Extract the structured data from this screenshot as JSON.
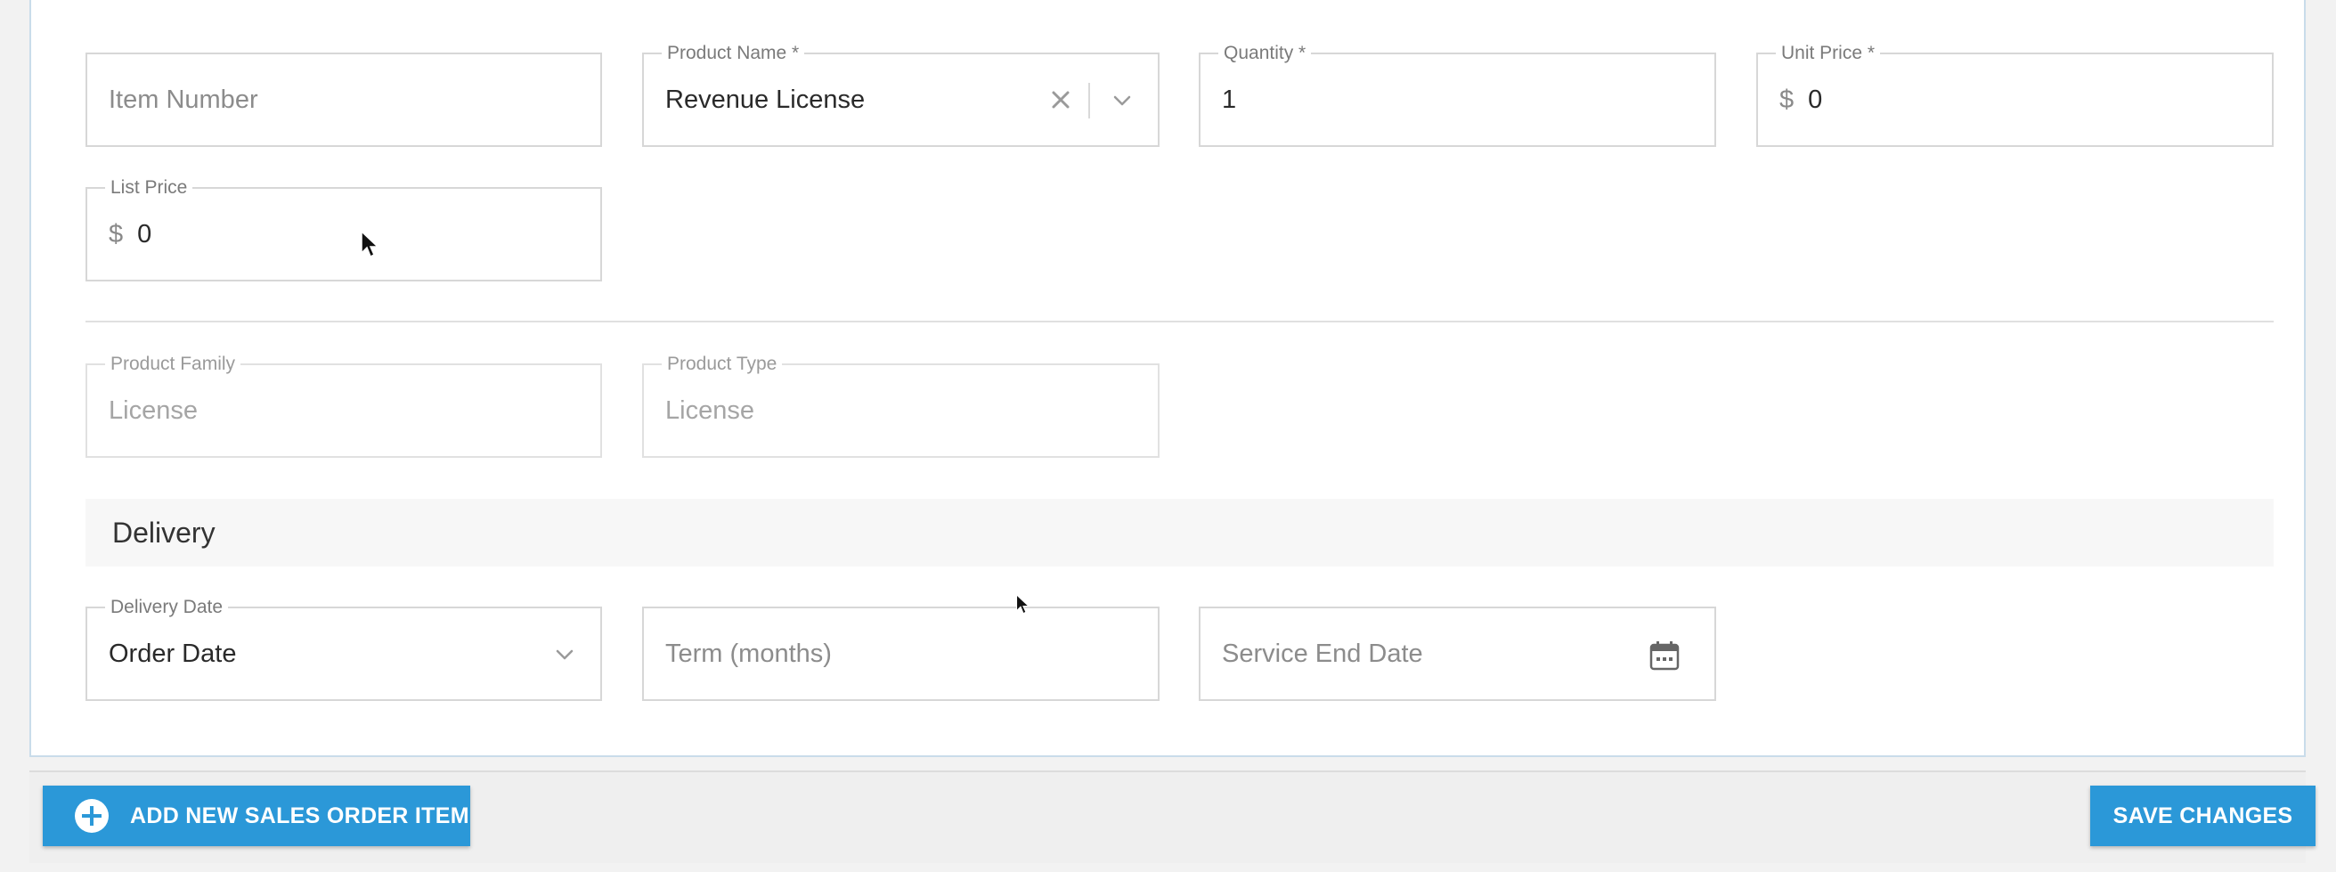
{
  "form": {
    "item_number": {
      "placeholder": "Item Number"
    },
    "product_name": {
      "label": "Product Name *",
      "value": "Revenue License",
      "clear_icon": "close-icon",
      "dropdown_icon": "chevron-down-icon"
    },
    "quantity": {
      "label": "Quantity *",
      "value": "1"
    },
    "unit_price": {
      "label": "Unit Price *",
      "currency": "$",
      "value": "0"
    },
    "list_price": {
      "label": "List Price",
      "currency": "$",
      "value": "0"
    },
    "product_family": {
      "label": "Product Family",
      "placeholder": "License"
    },
    "product_type": {
      "label": "Product Type",
      "placeholder": "License"
    }
  },
  "delivery": {
    "section_title": "Delivery",
    "delivery_date": {
      "label": "Delivery Date",
      "value": "Order Date",
      "dropdown_icon": "chevron-down-icon"
    },
    "term": {
      "placeholder": "Term (months)"
    },
    "service_end_date": {
      "placeholder": "Service End Date",
      "icon": "calendar-icon"
    }
  },
  "footer": {
    "add_button": {
      "label": "ADD NEW SALES ORDER ITEM",
      "icon": "plus-circle-icon"
    },
    "save_button": {
      "label": "SAVE CHANGES"
    }
  },
  "colors": {
    "accent": "#2b98d8",
    "border": "#d7d7d7",
    "card_border": "#c9dcea"
  }
}
